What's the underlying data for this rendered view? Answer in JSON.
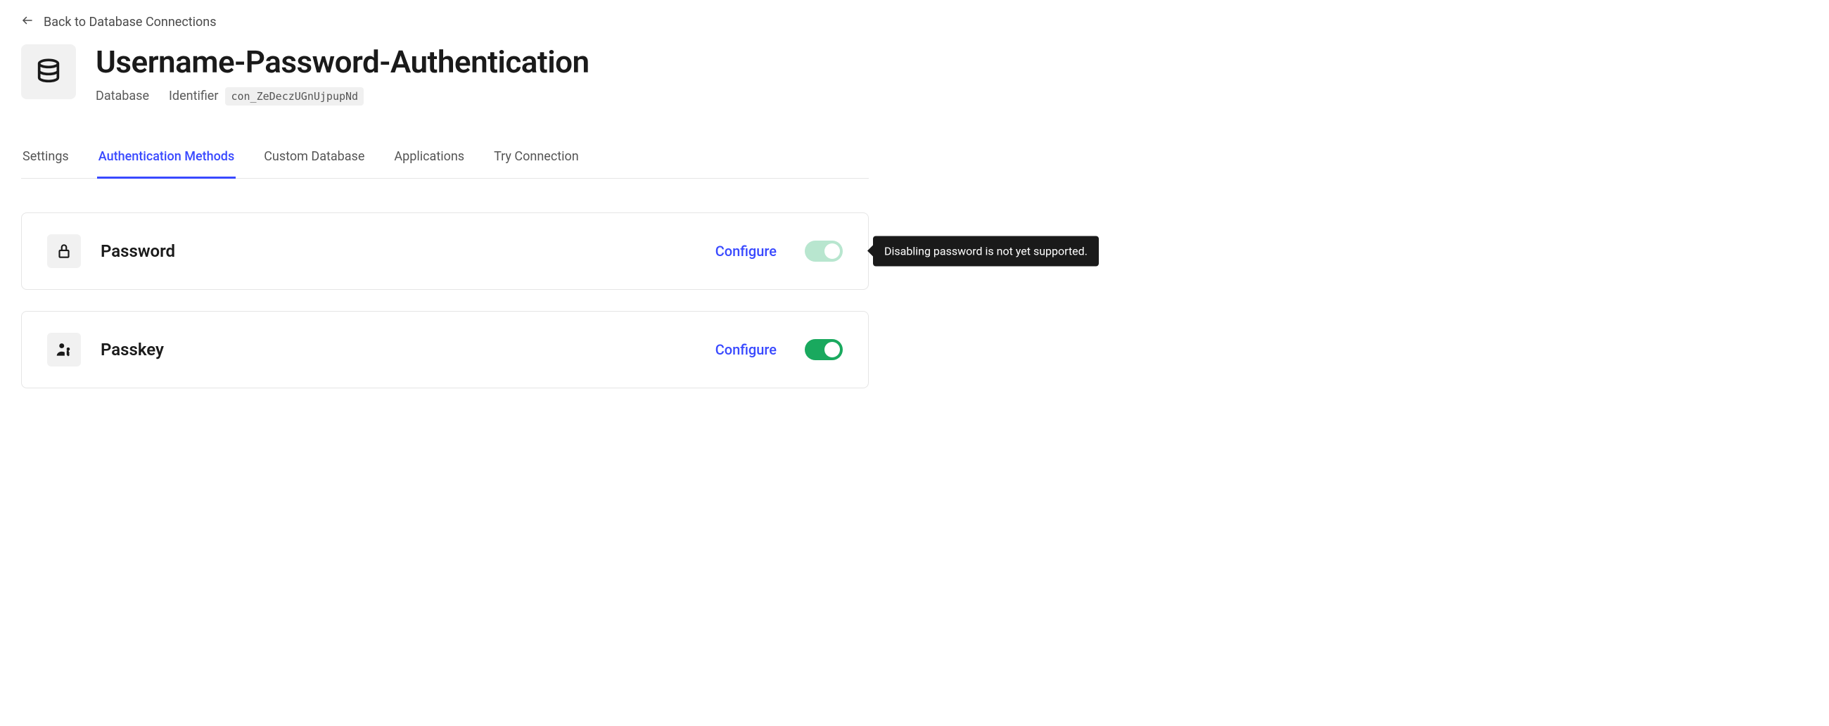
{
  "back": {
    "label": "Back to Database Connections"
  },
  "header": {
    "title": "Username-Password-Authentication",
    "type_label": "Database",
    "identifier_label": "Identifier",
    "identifier_value": "con_ZeDeczUGnUjpupNd"
  },
  "tabs": [
    {
      "label": "Settings"
    },
    {
      "label": "Authentication Methods",
      "active": true
    },
    {
      "label": "Custom Database"
    },
    {
      "label": "Applications"
    },
    {
      "label": "Try Connection"
    }
  ],
  "methods": {
    "password": {
      "title": "Password",
      "configure": "Configure",
      "enabled": true,
      "toggle_disabled": true,
      "tooltip": "Disabling password is not yet supported."
    },
    "passkey": {
      "title": "Passkey",
      "configure": "Configure",
      "enabled": true,
      "toggle_disabled": false
    }
  }
}
